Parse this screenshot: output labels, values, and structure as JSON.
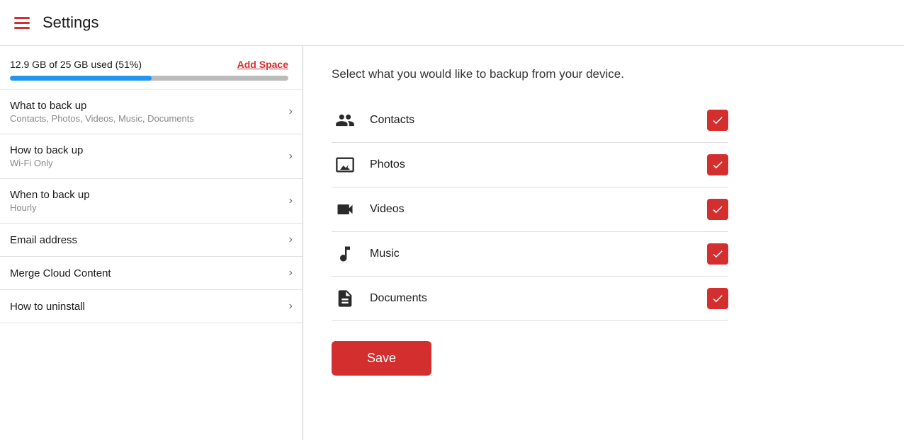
{
  "header": {
    "title": "Settings",
    "menu_icon_label": "menu"
  },
  "storage": {
    "text": "12.9 GB of 25 GB used (51%)",
    "add_space_label": "Add Space",
    "percent": 51
  },
  "menu_items": [
    {
      "id": "what-to-back-up",
      "title": "What to back up",
      "subtitle": "Contacts, Photos, Videos, Music, Documents"
    },
    {
      "id": "how-to-back-up",
      "title": "How to back up",
      "subtitle": "Wi-Fi Only"
    },
    {
      "id": "when-to-back-up",
      "title": "When to back up",
      "subtitle": "Hourly"
    },
    {
      "id": "email-address",
      "title": "Email address",
      "subtitle": ""
    },
    {
      "id": "merge-cloud-content",
      "title": "Merge Cloud Content",
      "subtitle": ""
    },
    {
      "id": "how-to-uninstall",
      "title": "How to uninstall",
      "subtitle": ""
    }
  ],
  "right_panel": {
    "title": "Select what you would like to backup from your device.",
    "backup_items": [
      {
        "id": "contacts",
        "label": "Contacts",
        "checked": true,
        "icon": "contacts"
      },
      {
        "id": "photos",
        "label": "Photos",
        "checked": true,
        "icon": "photos"
      },
      {
        "id": "videos",
        "label": "Videos",
        "checked": true,
        "icon": "videos"
      },
      {
        "id": "music",
        "label": "Music",
        "checked": true,
        "icon": "music"
      },
      {
        "id": "documents",
        "label": "Documents",
        "checked": true,
        "icon": "documents"
      }
    ],
    "save_label": "Save"
  }
}
